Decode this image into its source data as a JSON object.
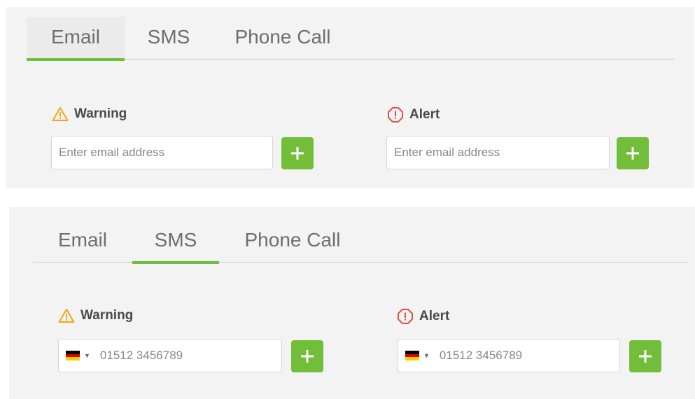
{
  "email_panel": {
    "tabs": [
      "Email",
      "SMS",
      "Phone Call"
    ],
    "active_tab": "Email",
    "warning": {
      "label": "Warning",
      "placeholder": "Enter email address"
    },
    "alert": {
      "label": "Alert",
      "placeholder": "Enter email address"
    }
  },
  "sms_panel": {
    "tabs": [
      "Email",
      "SMS",
      "Phone Call"
    ],
    "active_tab": "SMS",
    "warning": {
      "label": "Warning",
      "phone_placeholder": "01512 3456789",
      "country_flag": "flag-germany-icon"
    },
    "alert": {
      "label": "Alert",
      "phone_placeholder": "01512 3456789",
      "country_flag": "flag-germany-icon"
    }
  },
  "colors": {
    "accent_green": "#72bd3a",
    "warning_orange": "#f2a516",
    "alert_red": "#e0524a",
    "panel_bg": "#f3f3f3"
  }
}
